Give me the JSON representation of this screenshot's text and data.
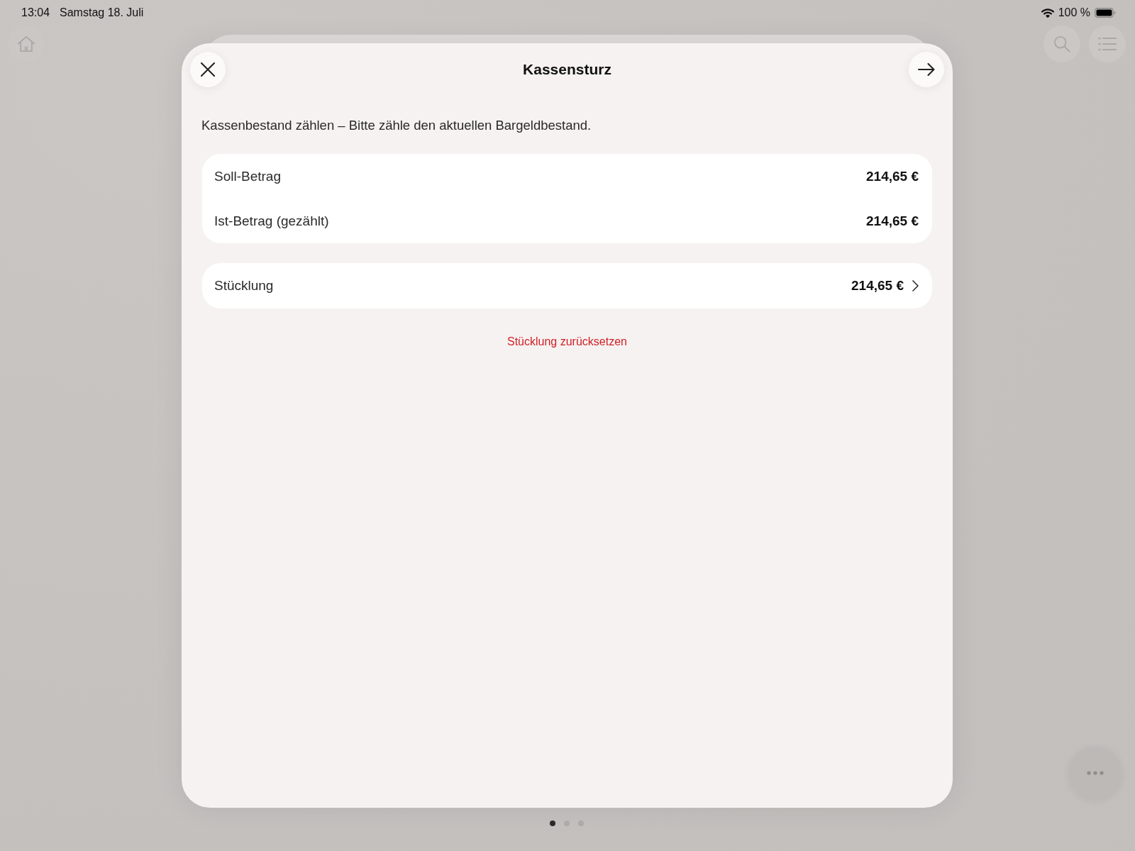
{
  "status_bar": {
    "time": "13:04",
    "date": "Samstag 18. Juli",
    "battery": "100 %"
  },
  "sheet": {
    "title": "Kassensturz",
    "description": "Kassenbestand zählen – Bitte zähle den aktuellen Bargeldbestand.",
    "summary_rows": [
      {
        "label": "Soll-Betrag",
        "value": "214,65 €"
      },
      {
        "label": "Ist-Betrag (gezählt)",
        "value": "214,65 €"
      }
    ],
    "denomination_row": {
      "label": "Stücklung",
      "value": "214,65 €"
    },
    "reset_link": "Stücklung zurücksetzen"
  },
  "page_indicator": [
    {
      "selected": true
    },
    {
      "selected": false
    },
    {
      "selected": false
    }
  ]
}
